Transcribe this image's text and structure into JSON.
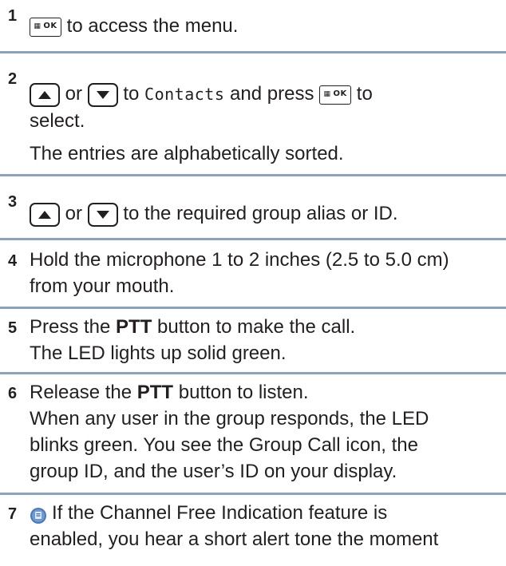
{
  "steps": [
    {
      "number": "1",
      "menu_key": "OK",
      "text_after_key": " to access the menu."
    },
    {
      "number": "2",
      "or_word": " or ",
      "text_to": " to ",
      "contacts_label": "Contacts",
      "text_press": " and press ",
      "text_to2": " to",
      "text_select": "select.",
      "text_sorted": "The entries are alphabetically sorted."
    },
    {
      "number": "3",
      "or_word": " or ",
      "text_after_keys": " to the required group alias or ID."
    },
    {
      "number": "4",
      "line1": "Hold the microphone 1 to 2 inches (2.5 to 5.0 cm)",
      "line2": "from your mouth."
    },
    {
      "number": "5",
      "press": "Press the ",
      "ptt": "PTT",
      "after_ptt": " button to make the call.",
      "line2": "The LED lights up solid green."
    },
    {
      "number": "6",
      "release": "Release the ",
      "ptt": "PTT",
      "after_ptt": " button to listen.",
      "line2": "When any user in the group responds, the LED",
      "line3": "blinks green. You see the Group Call icon, the",
      "line4": "group ID, and the user’s ID on your display."
    },
    {
      "number": "7",
      "line1": "If the Channel Free Indication feature is",
      "line2": "enabled, you hear a short alert tone the moment"
    }
  ],
  "icons": {
    "menu_ok_key": "menu-ok-key-icon",
    "up_arrow_key": "up-arrow-key-icon",
    "down_arrow_key": "down-arrow-key-icon",
    "feature_note": "feature-note-icon"
  },
  "colors": {
    "divider": "#8aa3c1",
    "text": "#231f20",
    "note_icon": "#4a78b8"
  }
}
